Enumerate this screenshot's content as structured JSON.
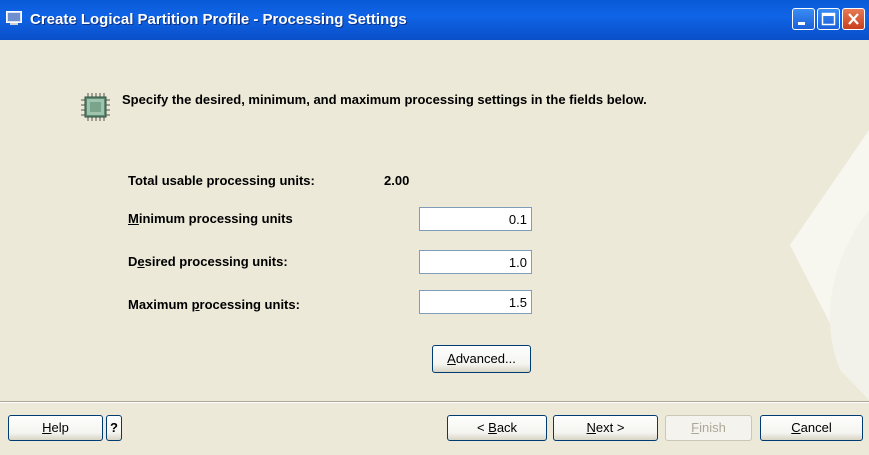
{
  "window": {
    "title": "Create Logical Partition Profile - Processing Settings"
  },
  "instructions": "Specify the desired, minimum, and maximum processing settings in the fields below.",
  "total": {
    "label": "Total usable processing units:",
    "value": "2.00"
  },
  "minimum": {
    "label_accel": "M",
    "label_rest": "inimum processing units",
    "value": "0.1"
  },
  "desired": {
    "label_pre": "D",
    "label_accel": "e",
    "label_rest": "sired processing units:",
    "value": "1.0"
  },
  "maximum": {
    "label_pre": "Maximum ",
    "label_accel": "p",
    "label_rest": "rocessing units:",
    "value": "1.5"
  },
  "buttons": {
    "advanced_accel": "A",
    "advanced_rest": "dvanced...",
    "help_accel": "H",
    "help_rest": "elp",
    "question": "?",
    "back_pre": "< ",
    "back_accel": "B",
    "back_rest": "ack",
    "next_accel": "N",
    "next_rest": "ext >",
    "finish_accel": "F",
    "finish_rest": "inish",
    "cancel_accel": "C",
    "cancel_rest": "ancel"
  },
  "colors": {
    "titlebar": "#0a5ad6",
    "dialog_bg": "#ece9d8",
    "disabled_text": "#aca899"
  }
}
